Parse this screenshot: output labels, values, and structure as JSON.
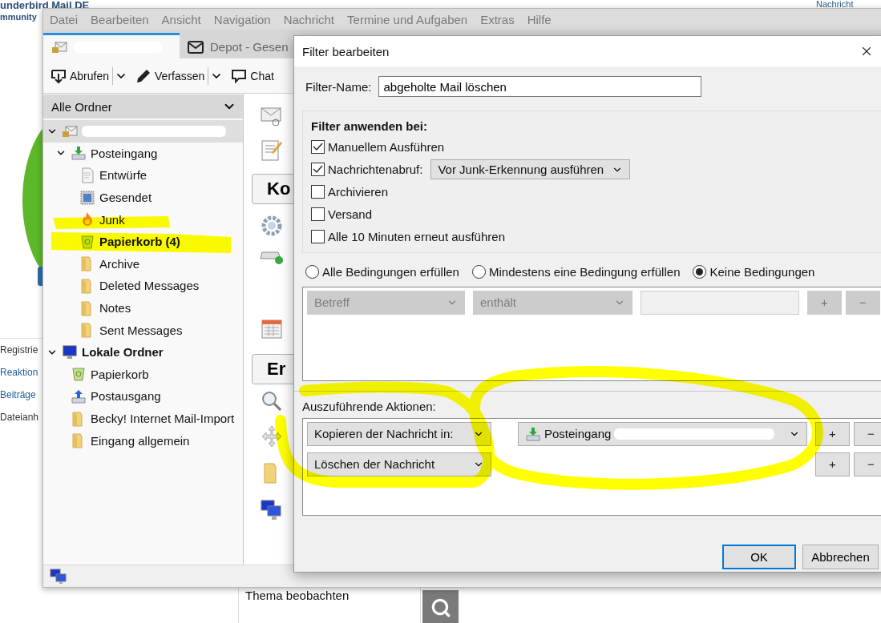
{
  "page": {
    "site_title": "underbird Mail DE",
    "tagline": "mmunity",
    "corner_link": "Nachricht",
    "side_texts": [
      {
        "text": "Registrie",
        "kind": "text"
      },
      {
        "text": "Reaktion",
        "kind": "link"
      },
      {
        "text": "Beiträge",
        "kind": "link"
      },
      {
        "text": "Dateianh",
        "kind": "text"
      }
    ],
    "list_item": "Thema beobachten"
  },
  "mail_window": {
    "menu": [
      "Datei",
      "Bearbeiten",
      "Ansicht",
      "Navigation",
      "Nachricht",
      "Termine und Aufgaben",
      "Extras",
      "Hilfe"
    ],
    "tabs": [
      {
        "kind": "account",
        "selected": true
      },
      {
        "kind": "mail",
        "label": "Depot - Gesen",
        "selected": false
      }
    ],
    "toolbar": [
      {
        "kind": "download",
        "label": "Abrufen",
        "menu": true
      },
      {
        "kind": "pencil",
        "label": "Verfassen",
        "menu": true
      },
      {
        "kind": "chat",
        "label": "Chat",
        "menu": false
      }
    ],
    "folder_pane": {
      "header": "Alle Ordner",
      "tree": [
        {
          "kind": "account",
          "selected": true,
          "expanded": true,
          "children": [
            {
              "kind": "inbox",
              "label": "Posteingang",
              "selected": false,
              "unread": false,
              "expanded": true,
              "children": [
                {
                  "kind": "drafts",
                  "label": "Entwürfe",
                  "selected": false,
                  "unread": false
                },
                {
                  "kind": "sent",
                  "label": "Gesendet",
                  "selected": false,
                  "unread": false
                },
                {
                  "kind": "junk",
                  "label": "Junk",
                  "selected": false,
                  "unread": false
                },
                {
                  "kind": "trash",
                  "label": "Papierkorb (4)",
                  "selected": false,
                  "unread": true
                },
                {
                  "kind": "folder",
                  "label": "Archive",
                  "selected": false,
                  "unread": false
                },
                {
                  "kind": "folder",
                  "label": "Deleted Messages",
                  "selected": false,
                  "unread": false
                },
                {
                  "kind": "folder",
                  "label": "Notes",
                  "selected": false,
                  "unread": false
                },
                {
                  "kind": "folder",
                  "label": "Sent Messages",
                  "selected": false,
                  "unread": false
                }
              ]
            }
          ]
        },
        {
          "kind": "local",
          "label": "Lokale Ordner",
          "selected": false,
          "expanded": true,
          "children": [
            {
              "kind": "trash",
              "label": "Papierkorb",
              "selected": false,
              "unread": false
            },
            {
              "kind": "outbox",
              "label": "Postausgang",
              "selected": false,
              "unread": false
            },
            {
              "kind": "folder",
              "label": "Becky! Internet Mail-Import",
              "selected": false,
              "unread": false
            },
            {
              "kind": "folder",
              "label": "Eingang allgemein",
              "selected": false,
              "unread": false
            }
          ]
        }
      ]
    },
    "side_buttons": [
      "Ko",
      "Er"
    ]
  },
  "dialog": {
    "title": "Filter bearbeiten",
    "name_label": "Filter-Name:",
    "name_value": "abgeholte Mail löschen",
    "apply_heading": "Filter anwenden bei:",
    "apply_options": [
      {
        "label": "Manuellem Ausführen",
        "checked": true
      },
      {
        "label": "Nachrichtenabruf:",
        "checked": true,
        "select": "Vor Junk-Erkennung ausführen"
      },
      {
        "label": "Archivieren",
        "checked": false
      },
      {
        "label": "Versand",
        "checked": false
      },
      {
        "label": "Alle 10 Minuten erneut ausführen",
        "checked": false
      }
    ],
    "match": [
      {
        "label": "Alle Bedingungen erfüllen",
        "selected": false
      },
      {
        "label": "Mindestens eine Bedingung erfüllen",
        "selected": false
      },
      {
        "label": "Keine Bedingungen",
        "selected": true
      }
    ],
    "conditions": [
      {
        "field": "Betreff",
        "operator": "enthält",
        "disabled": true,
        "add": "+",
        "remove": "−"
      }
    ],
    "actions_label": "Auszuführende Aktionen:",
    "actions": [
      {
        "action": "Kopieren der Nachricht in:",
        "target": "Posteingang",
        "add": "+",
        "remove": "−"
      },
      {
        "action": "Löschen der Nachricht",
        "add": "+",
        "remove": "−"
      }
    ],
    "buttons": [
      {
        "label": "OK",
        "default": true
      },
      {
        "label": "Abbrechen",
        "default": false
      }
    ]
  }
}
